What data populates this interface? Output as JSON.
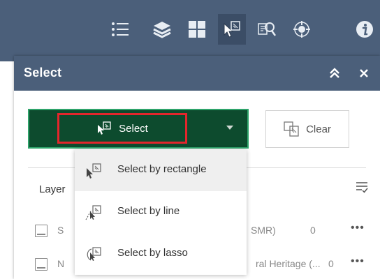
{
  "toolbar": {
    "icons": [
      "legend-icon",
      "layers-icon",
      "basemap-gallery-icon",
      "select-icon",
      "query-icon",
      "analysis-icon",
      "info-icon"
    ],
    "active": "select-icon"
  },
  "panel": {
    "title": "Select",
    "collapse_icon": "double-chevron-up-icon",
    "close_icon": "close-icon"
  },
  "select_button": {
    "label": "Select",
    "icon": "select-rectangle-icon"
  },
  "clear_button": {
    "label": "Clear",
    "icon": "clear-selection-icon"
  },
  "layers": {
    "label": "Layer",
    "rows": [
      {
        "name": "S",
        "name_tail": "SMR)",
        "count": "0",
        "more": "•••"
      },
      {
        "name": "N",
        "name_tail": "ral Heritage (...",
        "count": "0",
        "more": "•••"
      }
    ]
  },
  "dropdown": {
    "items": [
      {
        "label": "Select by rectangle",
        "icon": "select-by-rectangle-icon"
      },
      {
        "label": "Select by line",
        "icon": "select-by-line-icon"
      },
      {
        "label": "Select by lasso",
        "icon": "select-by-lasso-icon"
      }
    ]
  },
  "colors": {
    "toolbar_bg": "#4b5f7a",
    "select_button_bg": "#0d4b2e",
    "select_button_border": "#2ea36a",
    "highlight_border": "#e4262c"
  }
}
